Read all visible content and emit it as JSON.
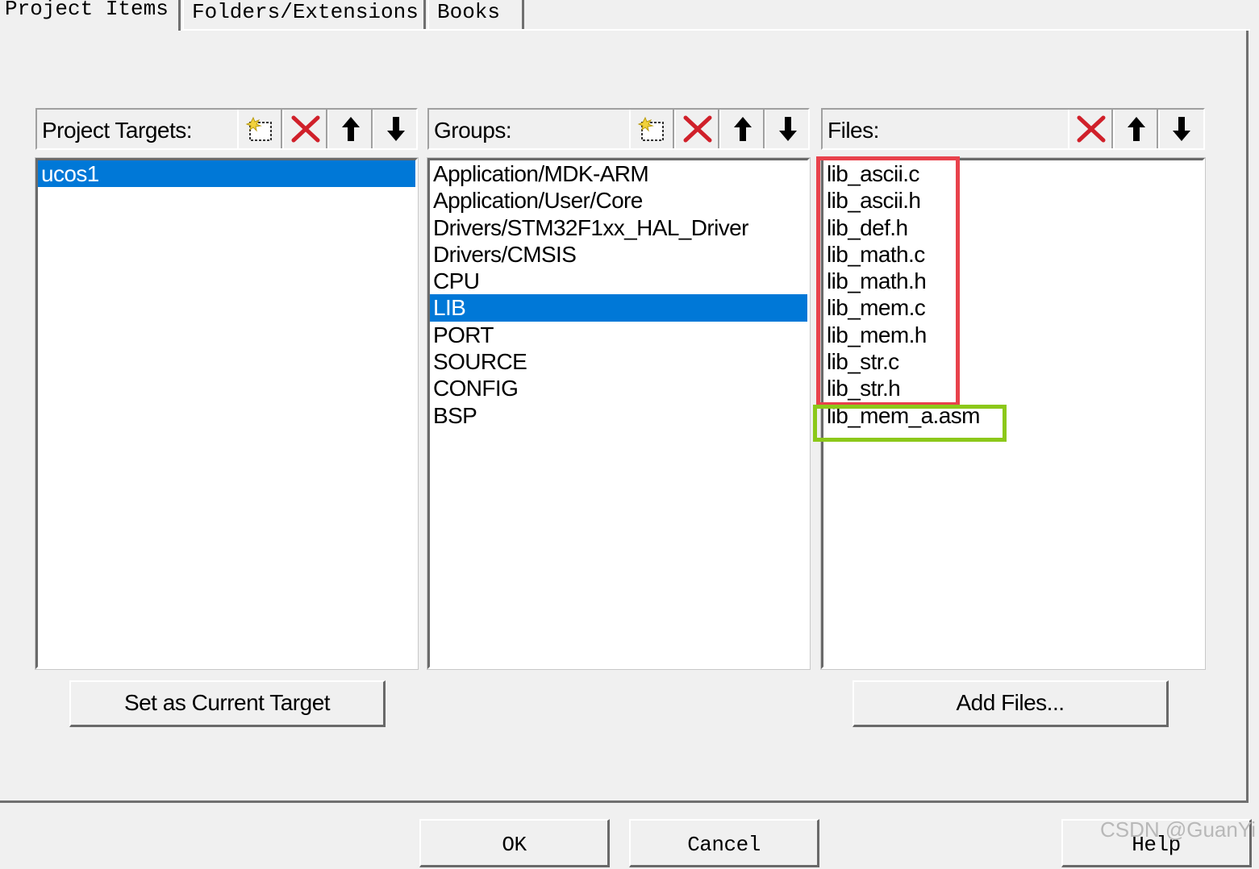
{
  "tabs": [
    "Project Items",
    "Folders/Extensions",
    "Books"
  ],
  "targets": {
    "label": "Project Targets:",
    "items": [
      "ucos1"
    ],
    "selected": 0
  },
  "groups": {
    "label": "Groups:",
    "items": [
      "Application/MDK-ARM",
      "Application/User/Core",
      "Drivers/STM32F1xx_HAL_Driver",
      "Drivers/CMSIS",
      "CPU",
      "LIB",
      "PORT",
      "SOURCE",
      "CONFIG",
      "BSP"
    ],
    "selected": 5
  },
  "files": {
    "label": "Files:",
    "items": [
      "lib_ascii.c",
      "lib_ascii.h",
      "lib_def.h",
      "lib_math.c",
      "lib_math.h",
      "lib_mem.c",
      "lib_mem.h",
      "lib_str.c",
      "lib_str.h",
      "lib_mem_a.asm"
    ]
  },
  "buttons": {
    "set_current": "Set as Current Target",
    "add_files": "Add Files...",
    "ok": "OK",
    "cancel": "Cancel",
    "help": "Help"
  },
  "watermark": "CSDN @GuanYi",
  "colors": {
    "selection": "#0078d7",
    "highlight_red": "#e8424c",
    "highlight_green": "#8cc81a",
    "delete_icon": "#d0202a"
  }
}
